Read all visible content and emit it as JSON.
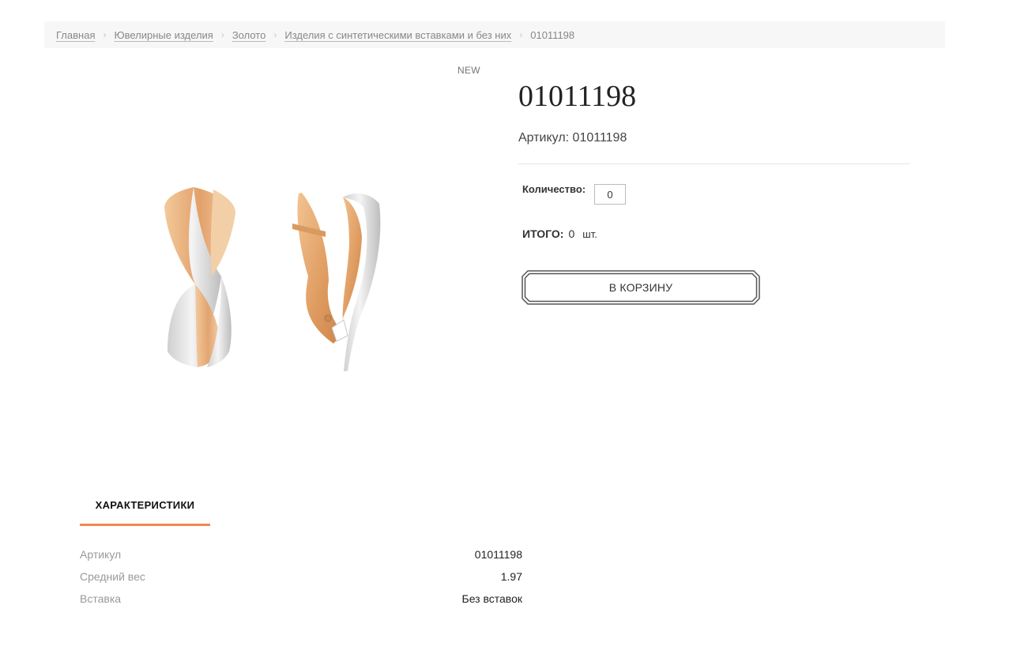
{
  "breadcrumb": {
    "items": [
      {
        "label": "Главная"
      },
      {
        "label": "Ювелирные изделия"
      },
      {
        "label": "Золото"
      },
      {
        "label": "Изделия с синтетическими вставками и без них"
      }
    ],
    "current": "01011198",
    "separator": "›"
  },
  "product": {
    "badge": "NEW",
    "title": "01011198",
    "article_line": "Артикул: 01011198",
    "quantity_label": "Количество:",
    "quantity_value": "0",
    "total_label": "ИТОГО:",
    "total_value": "0",
    "total_unit": "шт.",
    "cart_button": "В КОРЗИНУ"
  },
  "tabs": {
    "active": "ХАРАКТЕРИСТИКИ"
  },
  "specs": [
    {
      "name": "Артикул",
      "value": "01011198"
    },
    {
      "name": "Средний вес",
      "value": "1.97"
    },
    {
      "name": "Вставка",
      "value": "Без вставок"
    }
  ],
  "colors": {
    "accent": "#f0894f",
    "gold": "#e8a86f",
    "silver": "#d8d8d8"
  }
}
